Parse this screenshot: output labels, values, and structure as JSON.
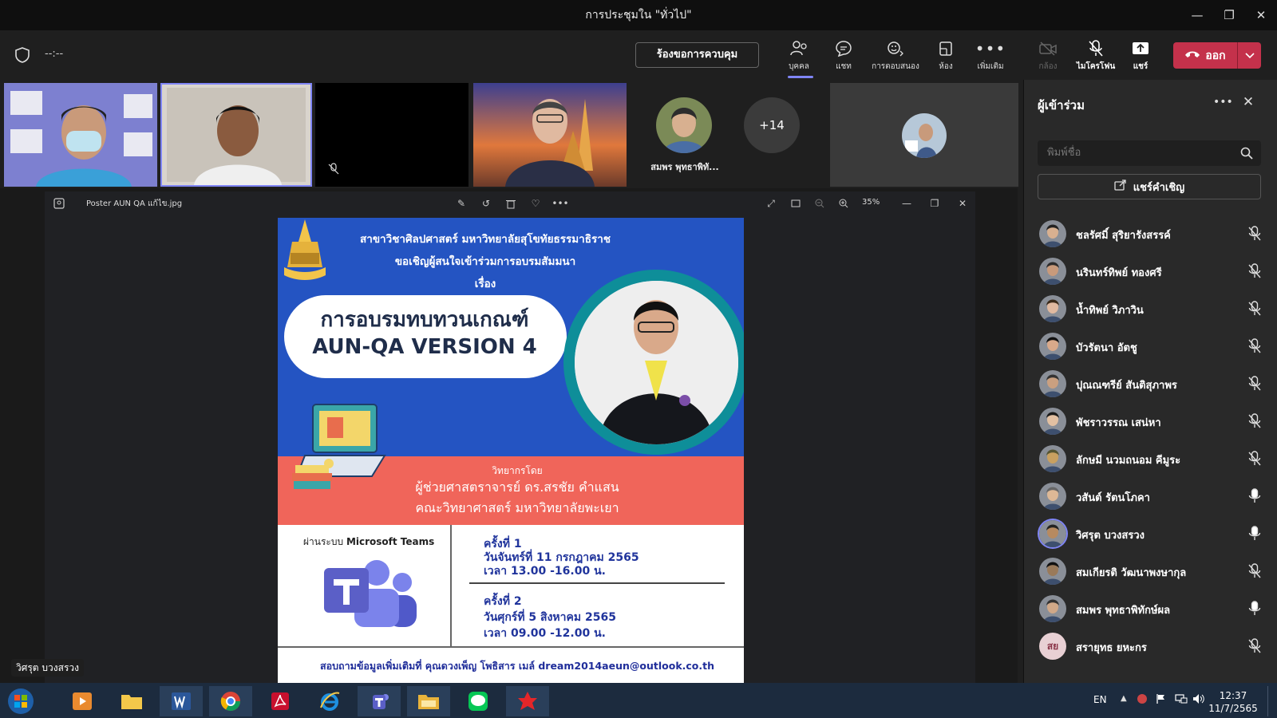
{
  "window": {
    "title": "การประชุมใน \"ทั่วไป\""
  },
  "toolbar": {
    "timer": "--:--",
    "request_control": "ร้องขอการควบคุม",
    "buttons": [
      {
        "label": "บุคคล",
        "icon": "people-icon"
      },
      {
        "label": "แชท",
        "icon": "chat-icon"
      },
      {
        "label": "การตอบสนอง",
        "icon": "reactions-icon"
      },
      {
        "label": "ห้อง",
        "icon": "rooms-icon"
      },
      {
        "label": "เพิ่มเติม",
        "icon": "more-icon"
      },
      {
        "label": "กล้อง",
        "icon": "camera-off-icon"
      },
      {
        "label": "ไมโครโฟน",
        "icon": "mic-off-icon"
      },
      {
        "label": "แชร์",
        "icon": "share-icon"
      }
    ],
    "leave": "ออก"
  },
  "gallery": {
    "participant_name": "สมพร พุทธาพิทั...",
    "overflow_count": "+14"
  },
  "viewer": {
    "file_name": "Poster AUN QA แก้ไข.jpg",
    "zoom": "35%"
  },
  "poster": {
    "line1": "สาขาวิชาศิลปศาสตร์ มหาวิทยาลัยสุโขทัยธรรมาธิราช",
    "line2": "ขอเชิญผู้สนใจเข้าร่วมการอบรมสัมมนา",
    "line3": "เรื่อง",
    "headline1": "การอบรมทบทวนเกณฑ์",
    "headline2": "AUN-QA VERSION 4",
    "speaker_label": "วิทยากรโดย",
    "speaker_name": "ผู้ช่วยศาสตราจารย์ ดร.สรชัย คำแสน",
    "speaker_org": "คณะวิทยาศาสตร์ มหาวิทยาลัยพะเยา",
    "platform_prefix": "ผ่านระบบ",
    "platform_name": "Microsoft Teams",
    "session1_title": "ครั้งที่ 1",
    "session1_date": "วันจันทร์ที่ 11 กรกฎาคม 2565",
    "session1_time": "เวลา 13.00 -16.00 น.",
    "session2_title": "ครั้งที่ 2",
    "session2_date": "วันศุกร์ที่ 5 สิงหาคม 2565",
    "session2_time": "เวลา 09.00 -12.00 น.",
    "contact": "สอบถามข้อมูลเพิ่มเติมที่ คุณดวงเพ็ญ โพธิสาร เมล์ dream2014aeun@outlook.co.th"
  },
  "presenter_name": "วิศรุต บวงสรวง",
  "panel": {
    "title": "ผู้เข้าร่วม",
    "search_placeholder": "พิมพ์ชื่อ",
    "share_invite": "แชร์คำเชิญ",
    "participants": [
      {
        "name": "ชลรัศมิ์ สุริยารังสรรค์",
        "mic": "muted"
      },
      {
        "name": "นรินทร์ทิพย์ ทองศรี",
        "mic": "muted"
      },
      {
        "name": "น้ำทิพย์ วิภาวิน",
        "mic": "muted"
      },
      {
        "name": "บัวรัตนา อัตชู",
        "mic": "muted"
      },
      {
        "name": "ปุณณฑรีย์ สันติสุภาพร",
        "mic": "muted"
      },
      {
        "name": "พัชราวรรณ เสน่หา",
        "mic": "muted"
      },
      {
        "name": "ลักษมี นวมถนอม คีมูระ",
        "mic": "muted"
      },
      {
        "name": "วสันต์ รัตนโภคา",
        "mic": "on"
      },
      {
        "name": "วิศรุต บวงสรวง",
        "mic": "on"
      },
      {
        "name": "สมเกียรติ วัฒนาพงษากุล",
        "mic": "muted"
      },
      {
        "name": "สมพร พุทธาพิทักษ์ผล",
        "mic": "on"
      },
      {
        "name": "สรายุทธ ยหะกร",
        "mic": "muted",
        "initials": "สย"
      }
    ]
  },
  "taskbar": {
    "language": "EN",
    "time": "12:37",
    "date": "11/7/2565"
  },
  "colors": {
    "accent": "#7f85f5",
    "leave": "#c4314b",
    "poster_blue": "#2454c2",
    "poster_coral": "#f0655a",
    "teal": "#0e8e99"
  }
}
